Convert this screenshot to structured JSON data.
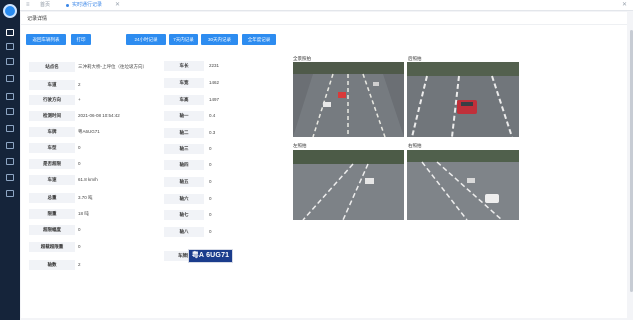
{
  "topbar": {
    "tab_home": "首页",
    "tab_current": "实时通行记录",
    "close_label": "✕"
  },
  "panel": {
    "title": "记录详情"
  },
  "buttons": {
    "back": "返回车辆列表",
    "print": "打印",
    "h24": "24小时记录",
    "d7": "7天内记录",
    "d30": "30天内记录",
    "all": "全年度记录"
  },
  "details_left": [
    {
      "label": "站点名",
      "value": "三沖莉大桥-上坪位（往垃圾方向）"
    },
    {
      "label": "车道",
      "value": "2"
    },
    {
      "label": "行驶方向",
      "value": "+"
    },
    {
      "label": "检测时间",
      "value": "2021-06-08 10:54:42"
    },
    {
      "label": "车牌",
      "value": "粤A6UG71"
    },
    {
      "label": "车型",
      "value": "0"
    },
    {
      "label": "是否超限",
      "value": "0"
    },
    {
      "label": "车速",
      "value": "61.8 km/h"
    },
    {
      "label": "总重",
      "value": "3.70 吨"
    },
    {
      "label": "限重",
      "value": "18 吨"
    },
    {
      "label": "超限幅度",
      "value": "0"
    },
    {
      "label": "超载超限重",
      "value": "0"
    },
    {
      "label": "轴数",
      "value": "2"
    }
  ],
  "details_right": [
    {
      "label": "车长",
      "value": "2231"
    },
    {
      "label": "车宽",
      "value": "1462"
    },
    {
      "label": "车高",
      "value": "1497"
    },
    {
      "label": "轴一",
      "value": "0.4"
    },
    {
      "label": "轴二",
      "value": "0.3"
    },
    {
      "label": "轴三",
      "value": "0"
    },
    {
      "label": "轴四",
      "value": "0"
    },
    {
      "label": "轴五",
      "value": "0"
    },
    {
      "label": "轴六",
      "value": "0"
    },
    {
      "label": "轴七",
      "value": "0"
    },
    {
      "label": "轴八",
      "value": "0"
    }
  ],
  "plate_photo": {
    "label": "车牌照拍",
    "text": "粤A 6UG71"
  },
  "photos": {
    "overview": "全景照拍",
    "rear": "后照拍",
    "left": "左照拍",
    "right": "右照拍"
  }
}
